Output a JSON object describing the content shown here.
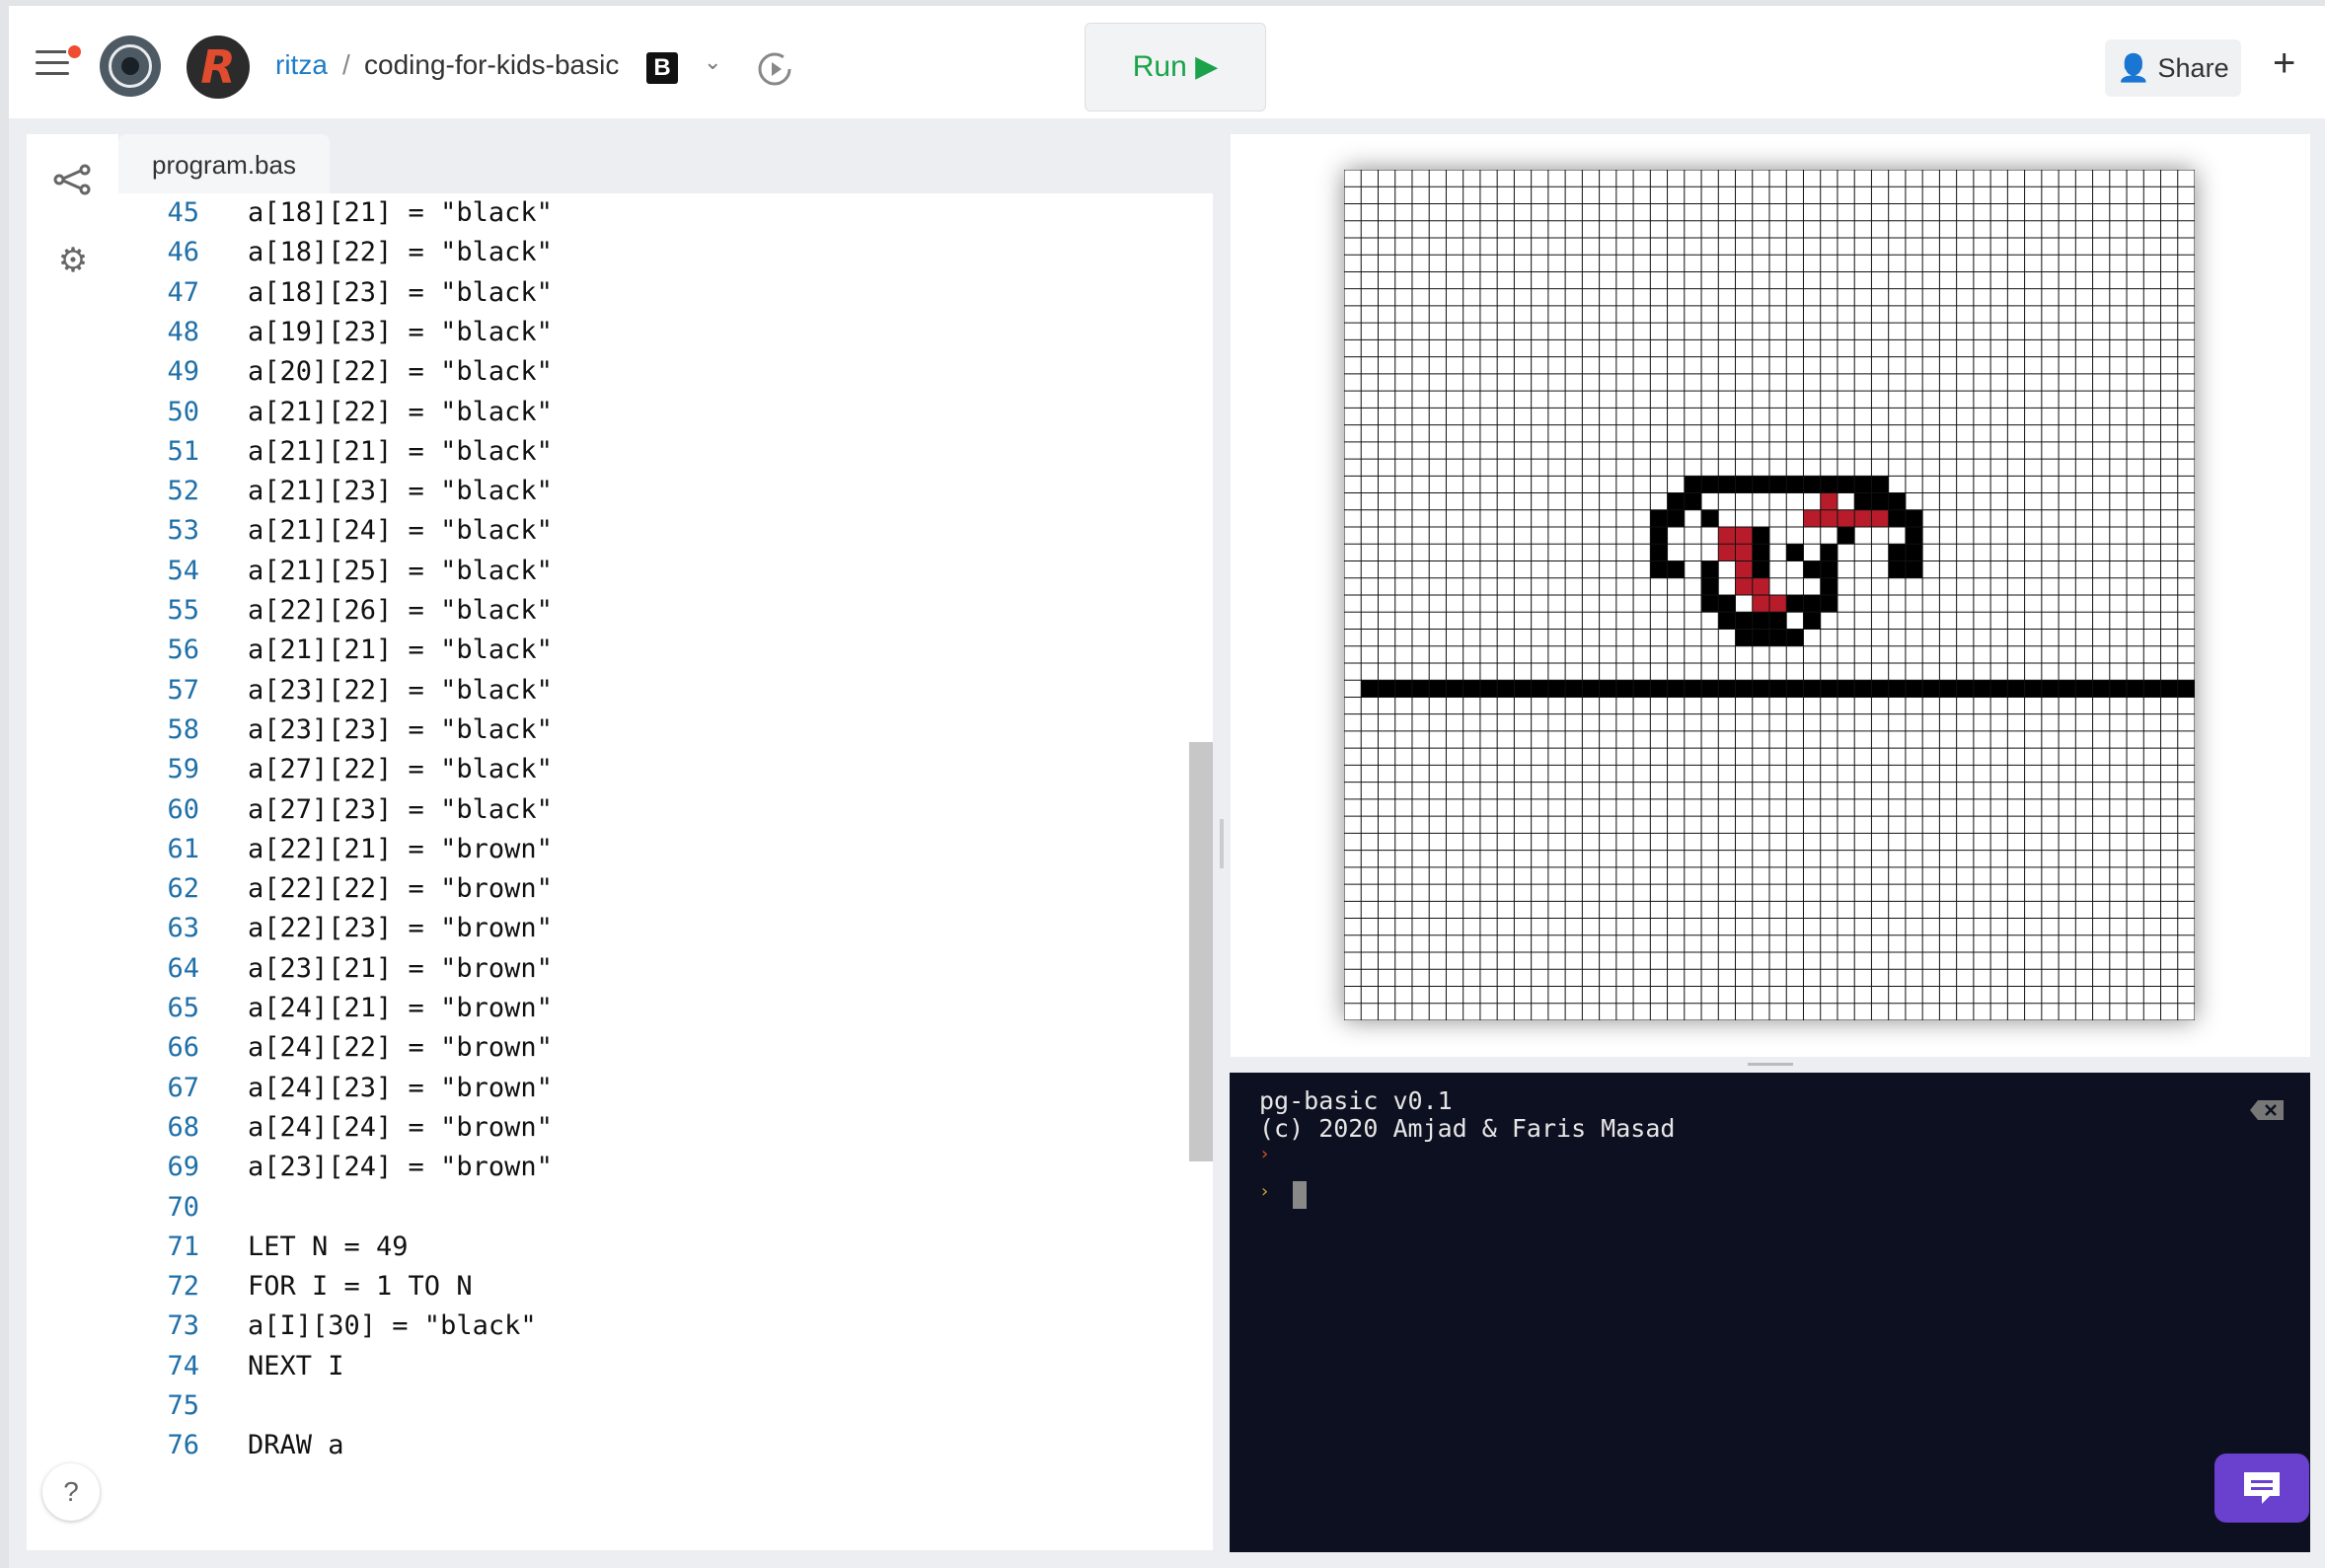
{
  "header": {
    "user": "ritza",
    "separator": "/",
    "repo": "coding-for-kids-basic",
    "avatar_letter": "R",
    "language_badge": "B",
    "run_label": "Run ▶",
    "share_label": "Share",
    "add_label": "+"
  },
  "editor": {
    "tab": "program.bas",
    "lines": [
      {
        "n": "45",
        "t": "a[18][21] = \"black\""
      },
      {
        "n": "46",
        "t": "a[18][22] = \"black\""
      },
      {
        "n": "47",
        "t": "a[18][23] = \"black\""
      },
      {
        "n": "48",
        "t": "a[19][23] = \"black\""
      },
      {
        "n": "49",
        "t": "a[20][22] = \"black\""
      },
      {
        "n": "50",
        "t": "a[21][22] = \"black\""
      },
      {
        "n": "51",
        "t": "a[21][21] = \"black\""
      },
      {
        "n": "52",
        "t": "a[21][23] = \"black\""
      },
      {
        "n": "53",
        "t": "a[21][24] = \"black\""
      },
      {
        "n": "54",
        "t": "a[21][25] = \"black\""
      },
      {
        "n": "55",
        "t": "a[22][26] = \"black\""
      },
      {
        "n": "56",
        "t": "a[21][21] = \"black\""
      },
      {
        "n": "57",
        "t": "a[23][22] = \"black\""
      },
      {
        "n": "58",
        "t": "a[23][23] = \"black\""
      },
      {
        "n": "59",
        "t": "a[27][22] = \"black\""
      },
      {
        "n": "60",
        "t": "a[27][23] = \"black\""
      },
      {
        "n": "61",
        "t": "a[22][21] = \"brown\""
      },
      {
        "n": "62",
        "t": "a[22][22] = \"brown\""
      },
      {
        "n": "63",
        "t": "a[22][23] = \"brown\""
      },
      {
        "n": "64",
        "t": "a[23][21] = \"brown\""
      },
      {
        "n": "65",
        "t": "a[24][21] = \"brown\""
      },
      {
        "n": "66",
        "t": "a[24][22] = \"brown\""
      },
      {
        "n": "67",
        "t": "a[24][23] = \"brown\""
      },
      {
        "n": "68",
        "t": "a[24][24] = \"brown\""
      },
      {
        "n": "69",
        "t": "a[23][24] = \"brown\""
      },
      {
        "n": "70",
        "t": ""
      },
      {
        "n": "71",
        "t": "LET N = 49"
      },
      {
        "n": "72",
        "t": "FOR I = 1 TO N"
      },
      {
        "n": "73",
        "t": "a[I][30] = \"black\""
      },
      {
        "n": "74",
        "t": "NEXT I"
      },
      {
        "n": "75",
        "t": ""
      },
      {
        "n": "76",
        "t": "DRAW a"
      }
    ]
  },
  "canvas": {
    "grid_size": 50,
    "black_cells": [
      [
        20,
        18
      ],
      [
        21,
        18
      ],
      [
        22,
        18
      ],
      [
        23,
        18
      ],
      [
        24,
        18
      ],
      [
        25,
        18
      ],
      [
        26,
        18
      ],
      [
        27,
        18
      ],
      [
        28,
        18
      ],
      [
        29,
        18
      ],
      [
        30,
        18
      ],
      [
        31,
        18
      ],
      [
        19,
        19
      ],
      [
        20,
        19
      ],
      [
        30,
        19
      ],
      [
        31,
        19
      ],
      [
        32,
        19
      ],
      [
        18,
        20
      ],
      [
        19,
        20
      ],
      [
        21,
        20
      ],
      [
        32,
        20
      ],
      [
        33,
        20
      ],
      [
        18,
        21
      ],
      [
        24,
        21
      ],
      [
        29,
        21
      ],
      [
        33,
        21
      ],
      [
        18,
        22
      ],
      [
        22,
        22
      ],
      [
        24,
        22
      ],
      [
        26,
        22
      ],
      [
        28,
        22
      ],
      [
        32,
        22
      ],
      [
        33,
        22
      ],
      [
        18,
        23
      ],
      [
        19,
        23
      ],
      [
        21,
        23
      ],
      [
        24,
        23
      ],
      [
        27,
        23
      ],
      [
        28,
        23
      ],
      [
        32,
        23
      ],
      [
        33,
        23
      ],
      [
        21,
        24
      ],
      [
        28,
        24
      ],
      [
        21,
        25
      ],
      [
        22,
        25
      ],
      [
        26,
        25
      ],
      [
        27,
        25
      ],
      [
        28,
        25
      ],
      [
        22,
        26
      ],
      [
        23,
        26
      ],
      [
        24,
        26
      ],
      [
        25,
        26
      ],
      [
        27,
        26
      ],
      [
        23,
        27
      ],
      [
        24,
        27
      ],
      [
        25,
        27
      ],
      [
        26,
        27
      ]
    ],
    "red_cells": [
      [
        28,
        19
      ],
      [
        27,
        20
      ],
      [
        28,
        20
      ],
      [
        29,
        20
      ],
      [
        30,
        20
      ],
      [
        31,
        20
      ],
      [
        22,
        21
      ],
      [
        23,
        21
      ],
      [
        22,
        22
      ],
      [
        23,
        22
      ],
      [
        23,
        23
      ],
      [
        24,
        24
      ],
      [
        23,
        24
      ],
      [
        24,
        25
      ],
      [
        25,
        25
      ]
    ],
    "ground_row": 30,
    "colors": {
      "black": "#000000",
      "red": "#b81c2a",
      "grid": "#111111"
    }
  },
  "console": {
    "line1": "pg-basic v0.1",
    "line2": "(c) 2020 Amjad & Faris Masad",
    "prompt": "›"
  },
  "icons": {
    "menu": "hamburger-icon",
    "history": "history-icon",
    "share_person": "user-plus-icon",
    "files": "share-graph-icon",
    "settings": "gear-icon",
    "help": "?",
    "chat": "chat-icon",
    "clear": "backspace-icon"
  }
}
